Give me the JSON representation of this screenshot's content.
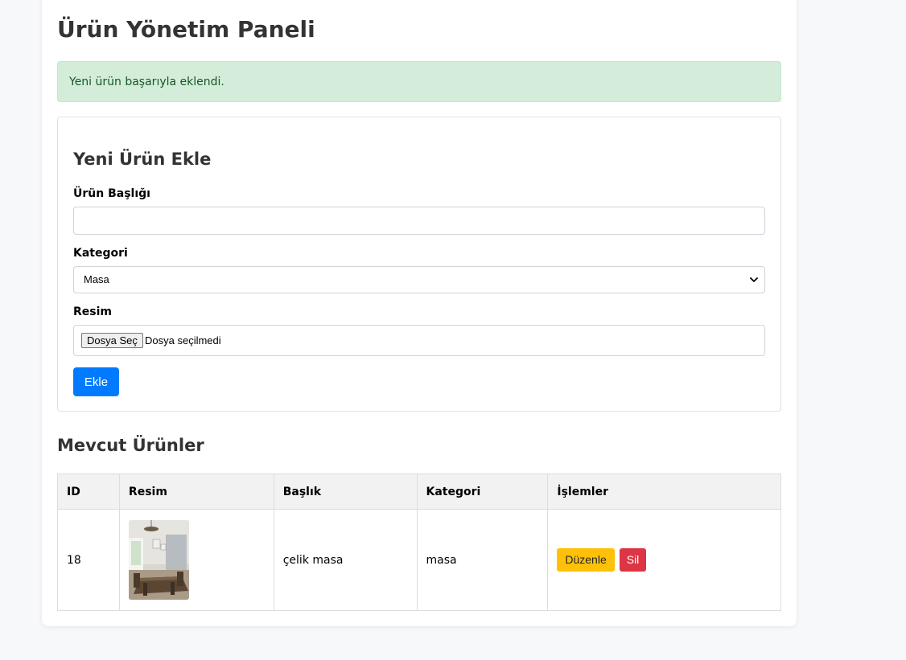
{
  "page": {
    "title": "Ürün Yönetim Paneli"
  },
  "alert": {
    "message": "Yeni ürün başarıyla eklendi."
  },
  "form": {
    "title": "Yeni Ürün Ekle",
    "title_field": {
      "label": "Ürün Başlığı",
      "value": ""
    },
    "category_field": {
      "label": "Kategori",
      "selected": "Masa"
    },
    "image_field": {
      "label": "Resim",
      "button_label": "Dosya Seç",
      "status": "Dosya seçilmedi"
    },
    "submit_label": "Ekle"
  },
  "products": {
    "title": "Mevcut Ürünler",
    "columns": [
      "ID",
      "Resim",
      "Başlık",
      "Kategori",
      "İşlemler"
    ],
    "rows": [
      {
        "id": "18",
        "title": "çelik masa",
        "category": "masa",
        "edit_label": "Düzenle",
        "delete_label": "Sil"
      }
    ]
  },
  "colors": {
    "primary": "#007bff",
    "success_bg": "#d4edda",
    "success_text": "#155724",
    "warning": "#ffc107",
    "danger": "#dc3545"
  },
  "icons": {
    "select_chevron": "chevron-down-icon"
  }
}
